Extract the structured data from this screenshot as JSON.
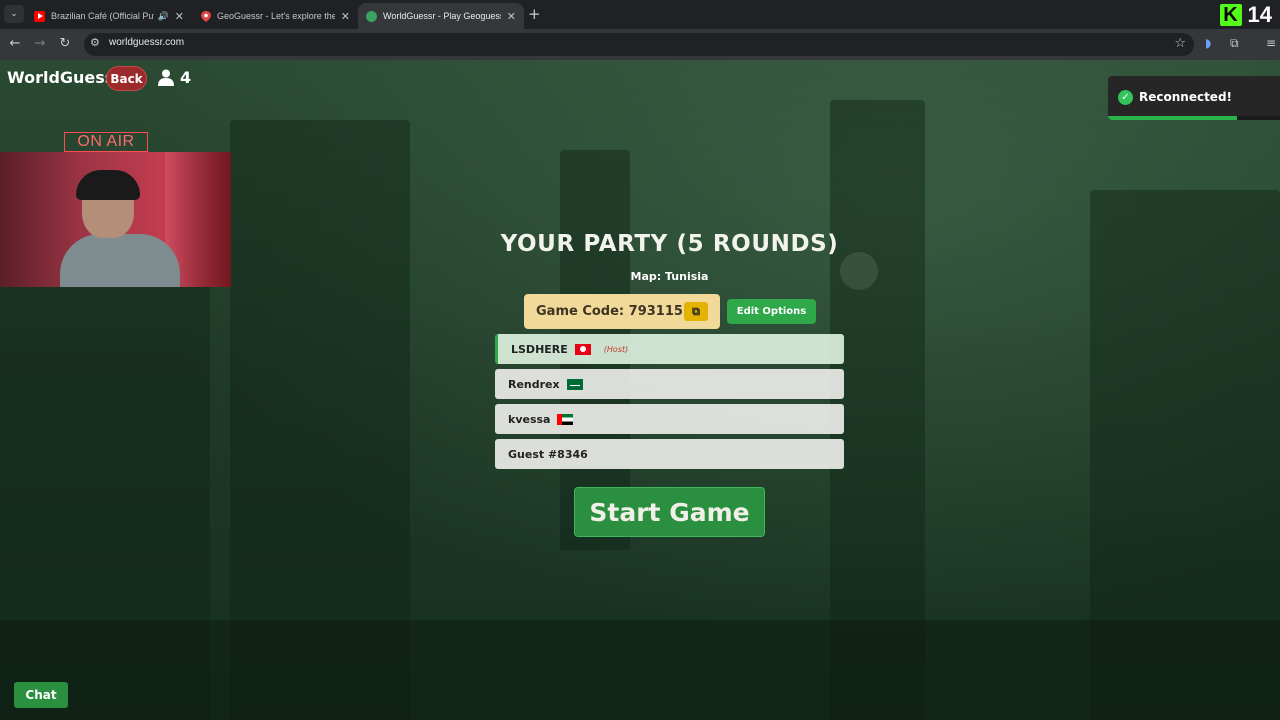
{
  "browser": {
    "tabs": [
      {
        "title": "Brazilian Café (Official Putumayo",
        "favicon": "youtube-icon",
        "favicon_color": "#ff0000",
        "audio": true,
        "active": false
      },
      {
        "title": "GeoGuessr - Let's explore the world",
        "favicon": "map-pin-icon",
        "favicon_color": "#e04848",
        "audio": false,
        "active": false
      },
      {
        "title": "WorldGuessr - Play Geoguessr Free",
        "favicon": "globe-icon",
        "favicon_color": "#3aa35f",
        "audio": false,
        "active": true
      }
    ],
    "url": "worldguessr.com",
    "kick_count": "14"
  },
  "header": {
    "brand": "WorldGuessr",
    "back_label": "Back",
    "player_count": "4"
  },
  "stream": {
    "on_air_label": "ON AIR"
  },
  "toast": {
    "message": "Reconnected!",
    "progress": 0.75,
    "accent_color": "#2bb34b"
  },
  "party": {
    "title": "YOUR PARTY (5 ROUNDS)",
    "map_label": "Map: Tunisia",
    "game_code_label": "Game Code: 793115",
    "edit_options_label": "Edit Options",
    "start_label": "Start Game",
    "host_tag": "(Host)",
    "players": [
      {
        "name": "LSDHERE",
        "flag": "tunisia-flag",
        "host": true
      },
      {
        "name": "Rendrex",
        "flag": "saudi-arabia-flag",
        "host": false
      },
      {
        "name": "kvessa",
        "flag": "uae-flag",
        "host": false
      },
      {
        "name": "Guest #8346",
        "flag": "",
        "host": false
      }
    ]
  },
  "chat": {
    "label": "Chat"
  },
  "colors": {
    "accent_green": "#2a8f3e",
    "code_bg": "#f0d999",
    "back_red": "#9b2b2b"
  }
}
